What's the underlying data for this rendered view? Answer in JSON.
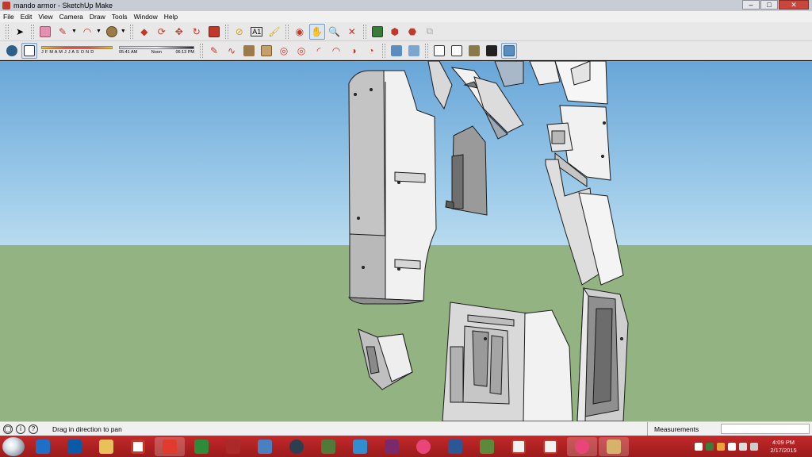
{
  "window": {
    "title": "mando armor - SketchUp Make",
    "controls": {
      "minimize": "–",
      "maximize": "□",
      "close": "✕"
    }
  },
  "menu": [
    "File",
    "Edit",
    "View",
    "Camera",
    "Draw",
    "Tools",
    "Window",
    "Help"
  ],
  "toolbar1": {
    "icons": [
      "select-icon",
      "eraser-icon",
      "pencil-icon",
      "arc-icon",
      "circle-icon",
      "push-pull-icon",
      "follow-me-icon",
      "move-icon",
      "rotate-icon",
      "scale-icon",
      "tape-measure-icon",
      "text-icon",
      "paint-bucket-icon",
      "orbit-icon",
      "pan-icon",
      "zoom-icon",
      "zoom-extents-icon",
      "add-location-icon",
      "3d-warehouse-icon",
      "extension-warehouse-icon",
      "layout-icon"
    ]
  },
  "toolbar2": {
    "shadow_months": "J F M A M J J A S O N D",
    "time_start": "05:41 AM",
    "time_mid": "Noon",
    "time_end": "06:13 PM",
    "icons": [
      "sandbox-smoove-icon",
      "sandbox-stamp-icon",
      "sandbox-drape-icon",
      "sandbox-add-detail-icon",
      "sandbox-flip-edge-icon",
      "arc-2-icon",
      "pie-icon",
      "3pt-arc-icon",
      "offset-icon",
      "xray-icon",
      "back-edges-icon",
      "wireframe-icon",
      "hidden-line-icon",
      "shaded-icon",
      "shaded-textures-icon",
      "monochrome-icon"
    ]
  },
  "status": {
    "hint": "Drag in direction to pan",
    "measurements_label": "Measurements"
  },
  "taskbar": {
    "apps": [
      "internet-explorer-icon",
      "outlook-icon",
      "file-explorer-icon",
      "quicken-icon",
      "sketchup-icon",
      "app-green-icon",
      "app-network-icon",
      "dropbox-icon",
      "steam-icon",
      "halo-icon",
      "sketchup-3d-icon",
      "winamp-icon",
      "itunes-icon",
      "word-icon",
      "minecraft-icon",
      "app-red-icon",
      "app-red2-icon",
      "itunes-2-icon",
      "paint-icon"
    ],
    "time": "4:09 PM",
    "date": "2/17/2015"
  },
  "colors": {
    "sky": "#68a6d8",
    "ground": "#93b382",
    "taskbar": "#b32223",
    "model_face": "#ececec",
    "model_shadow": "#8d8d8d"
  }
}
